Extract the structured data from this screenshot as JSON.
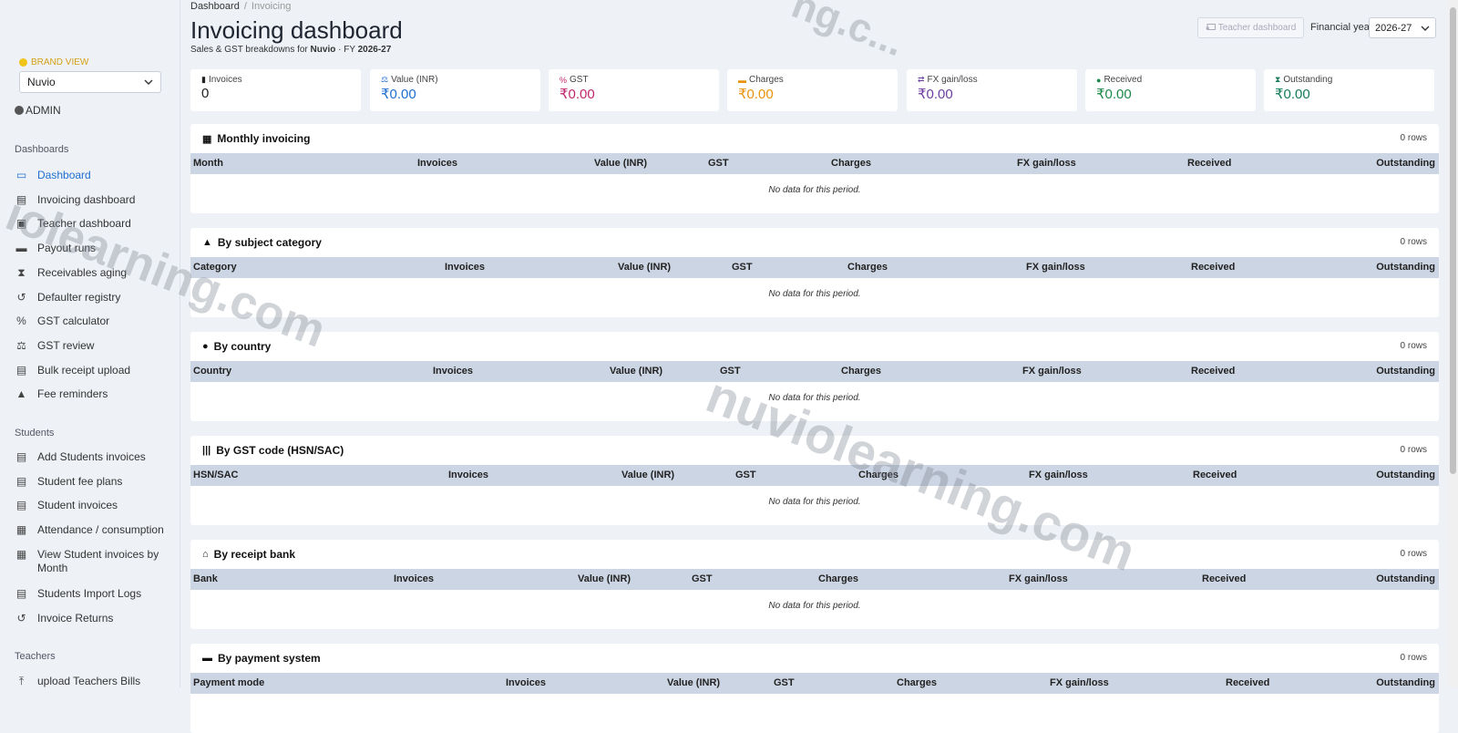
{
  "brand": {
    "label": "BRAND VIEW",
    "value": "Nuvio"
  },
  "user": {
    "role": "ADMIN"
  },
  "sidebar": {
    "sections": [
      {
        "title": "Dashboards"
      },
      {
        "title": "Students"
      },
      {
        "title": "Teachers"
      }
    ],
    "dashboards": [
      {
        "label": "Dashboard",
        "icon": "laptop-icon"
      },
      {
        "label": "Invoicing dashboard",
        "icon": "file-invoice-icon"
      },
      {
        "label": "Teacher dashboard",
        "icon": "chalkboard-user-icon"
      },
      {
        "label": "Payout runs",
        "icon": "money-check-icon"
      },
      {
        "label": "Receivables aging",
        "icon": "hourglass-icon"
      },
      {
        "label": "Defaulter registry",
        "icon": "history-icon"
      },
      {
        "label": "GST calculator",
        "icon": "percent-icon"
      },
      {
        "label": "GST review",
        "icon": "scale-icon"
      },
      {
        "label": "Bulk receipt upload",
        "icon": "file-upload-icon"
      },
      {
        "label": "Fee reminders",
        "icon": "bell-icon"
      }
    ],
    "students": [
      {
        "label": "Add Students invoices",
        "icon": "file-pen-icon"
      },
      {
        "label": "Student fee plans",
        "icon": "file-invoice-icon"
      },
      {
        "label": "Student invoices",
        "icon": "file-invoice-icon"
      },
      {
        "label": "Attendance / consumption",
        "icon": "calendar-check-icon"
      },
      {
        "label": "View Student invoices by Month",
        "icon": "calendar-icon"
      },
      {
        "label": "Students Import Logs",
        "icon": "file-import-icon"
      },
      {
        "label": "Invoice Returns",
        "icon": "undo-icon"
      }
    ],
    "teachers": [
      {
        "label": "upload Teachers Bills",
        "icon": "upload-icon"
      }
    ]
  },
  "breadcrumb": {
    "root": "Dashboard",
    "sep": "/",
    "current": "Invoicing"
  },
  "header": {
    "title": "Invoicing dashboard",
    "subtitle_prefix": "Sales & GST breakdowns for",
    "brand": "Nuvio",
    "fy_prefix": "· FY",
    "fy": "2026-27",
    "teacher_button": "Teacher dashboard",
    "fy_label": "Financial year",
    "fy_select": "2026-27"
  },
  "stats": [
    {
      "label": "Invoices",
      "value": "0",
      "icon": "file-icon",
      "color": "#222222"
    },
    {
      "label": "Value (INR)",
      "value": "₹0.00",
      "icon": "scale-icon",
      "color": "#1f6fd1"
    },
    {
      "label": "GST",
      "value": "₹0.00",
      "icon": "percent-icon",
      "color": "#c0266d"
    },
    {
      "label": "Charges",
      "value": "₹0.00",
      "icon": "money-bill-icon",
      "color": "#e8930c"
    },
    {
      "label": "FX gain/loss",
      "value": "₹0.00",
      "icon": "exchange-icon",
      "color": "#6b3fa0"
    },
    {
      "label": "Received",
      "value": "₹0.00",
      "icon": "check-circle-icon",
      "color": "#1c8a4a"
    },
    {
      "label": "Outstanding",
      "value": "₹0.00",
      "icon": "hourglass-icon",
      "color": "#157a5a"
    }
  ],
  "cards": [
    {
      "title": "Monthly invoicing",
      "icon": "calendar-icon",
      "rows": "0 rows",
      "empty": "No data for this period.",
      "columns": [
        "Month",
        "Invoices",
        "Value (INR)",
        "GST",
        "Charges",
        "FX gain/loss",
        "Received",
        "Outstanding"
      ]
    },
    {
      "title": "By subject category",
      "icon": "shapes-icon",
      "rows": "0 rows",
      "empty": "No data for this period.",
      "columns": [
        "Category",
        "Invoices",
        "Value (INR)",
        "GST",
        "Charges",
        "FX gain/loss",
        "Received",
        "Outstanding"
      ]
    },
    {
      "title": "By country",
      "icon": "globe-icon",
      "rows": "0 rows",
      "empty": "No data for this period.",
      "columns": [
        "Country",
        "Invoices",
        "Value (INR)",
        "GST",
        "Charges",
        "FX gain/loss",
        "Received",
        "Outstanding"
      ]
    },
    {
      "title": "By GST code (HSN/SAC)",
      "icon": "barcode-icon",
      "rows": "0 rows",
      "empty": "No data for this period.",
      "columns": [
        "HSN/SAC",
        "Invoices",
        "Value (INR)",
        "GST",
        "Charges",
        "FX gain/loss",
        "Received",
        "Outstanding"
      ]
    },
    {
      "title": "By receipt bank",
      "icon": "bank-icon",
      "rows": "0 rows",
      "empty": "No data for this period.",
      "columns": [
        "Bank",
        "Invoices",
        "Value (INR)",
        "GST",
        "Charges",
        "FX gain/loss",
        "Received",
        "Outstanding"
      ]
    },
    {
      "title": "By payment system",
      "icon": "credit-card-icon",
      "rows": "0 rows",
      "empty": "",
      "columns": [
        "Payment mode",
        "Invoices",
        "Value (INR)",
        "GST",
        "Charges",
        "FX gain/loss",
        "Received",
        "Outstanding"
      ]
    }
  ],
  "watermarks": [
    "iolearning.com",
    "nuviolearning.com",
    "ng.c..."
  ]
}
